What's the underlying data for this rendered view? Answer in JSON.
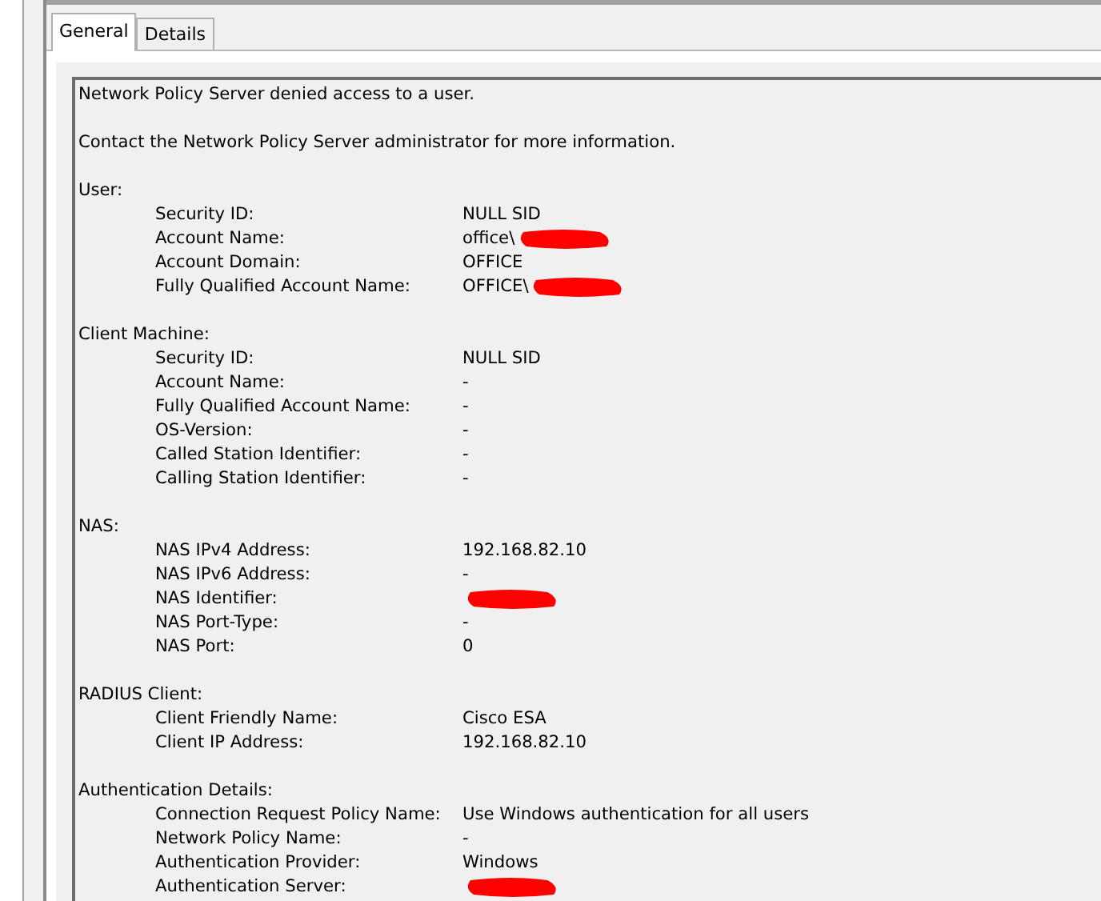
{
  "tabs": [
    {
      "label": "General",
      "selected": true
    },
    {
      "label": "Details",
      "selected": false
    }
  ],
  "intro": [
    "Network Policy Server denied access to a user.",
    "Contact the Network Policy Server administrator for more information."
  ],
  "sections": [
    {
      "title": "User:",
      "fields": [
        {
          "label": "Security ID:",
          "value": "NULL SID"
        },
        {
          "label": "Account Name:",
          "value": "office\\",
          "redacted": true
        },
        {
          "label": "Account Domain:",
          "value": "OFFICE"
        },
        {
          "label": "Fully Qualified Account Name:",
          "value": "OFFICE\\",
          "redacted": true
        }
      ]
    },
    {
      "title": "Client Machine:",
      "fields": [
        {
          "label": "Security ID:",
          "value": "NULL SID"
        },
        {
          "label": "Account Name:",
          "value": "-"
        },
        {
          "label": "Fully Qualified Account Name:",
          "value": "-"
        },
        {
          "label": "OS-Version:",
          "value": "-"
        },
        {
          "label": "Called Station Identifier:",
          "value": "-"
        },
        {
          "label": "Calling Station Identifier:",
          "value": "-"
        }
      ]
    },
    {
      "title": "NAS:",
      "fields": [
        {
          "label": "NAS IPv4 Address:",
          "value": "192.168.82.10"
        },
        {
          "label": "NAS IPv6 Address:",
          "value": "-"
        },
        {
          "label": "NAS Identifier:",
          "redacted": true
        },
        {
          "label": "NAS Port-Type:",
          "value": "-"
        },
        {
          "label": "NAS Port:",
          "value": "0"
        }
      ]
    },
    {
      "title": "RADIUS Client:",
      "fields": [
        {
          "label": "Client Friendly Name:",
          "value": "Cisco ESA"
        },
        {
          "label": "Client IP Address:",
          "value": "192.168.82.10"
        }
      ]
    },
    {
      "title": "Authentication Details:",
      "fields": [
        {
          "label": "Connection Request Policy Name:",
          "value": "Use Windows authentication for all users"
        },
        {
          "label": "Network Policy Name:",
          "value": "-"
        },
        {
          "label": "Authentication Provider:",
          "value": "Windows"
        },
        {
          "label": "Authentication Server:",
          "redacted": true
        }
      ]
    }
  ]
}
